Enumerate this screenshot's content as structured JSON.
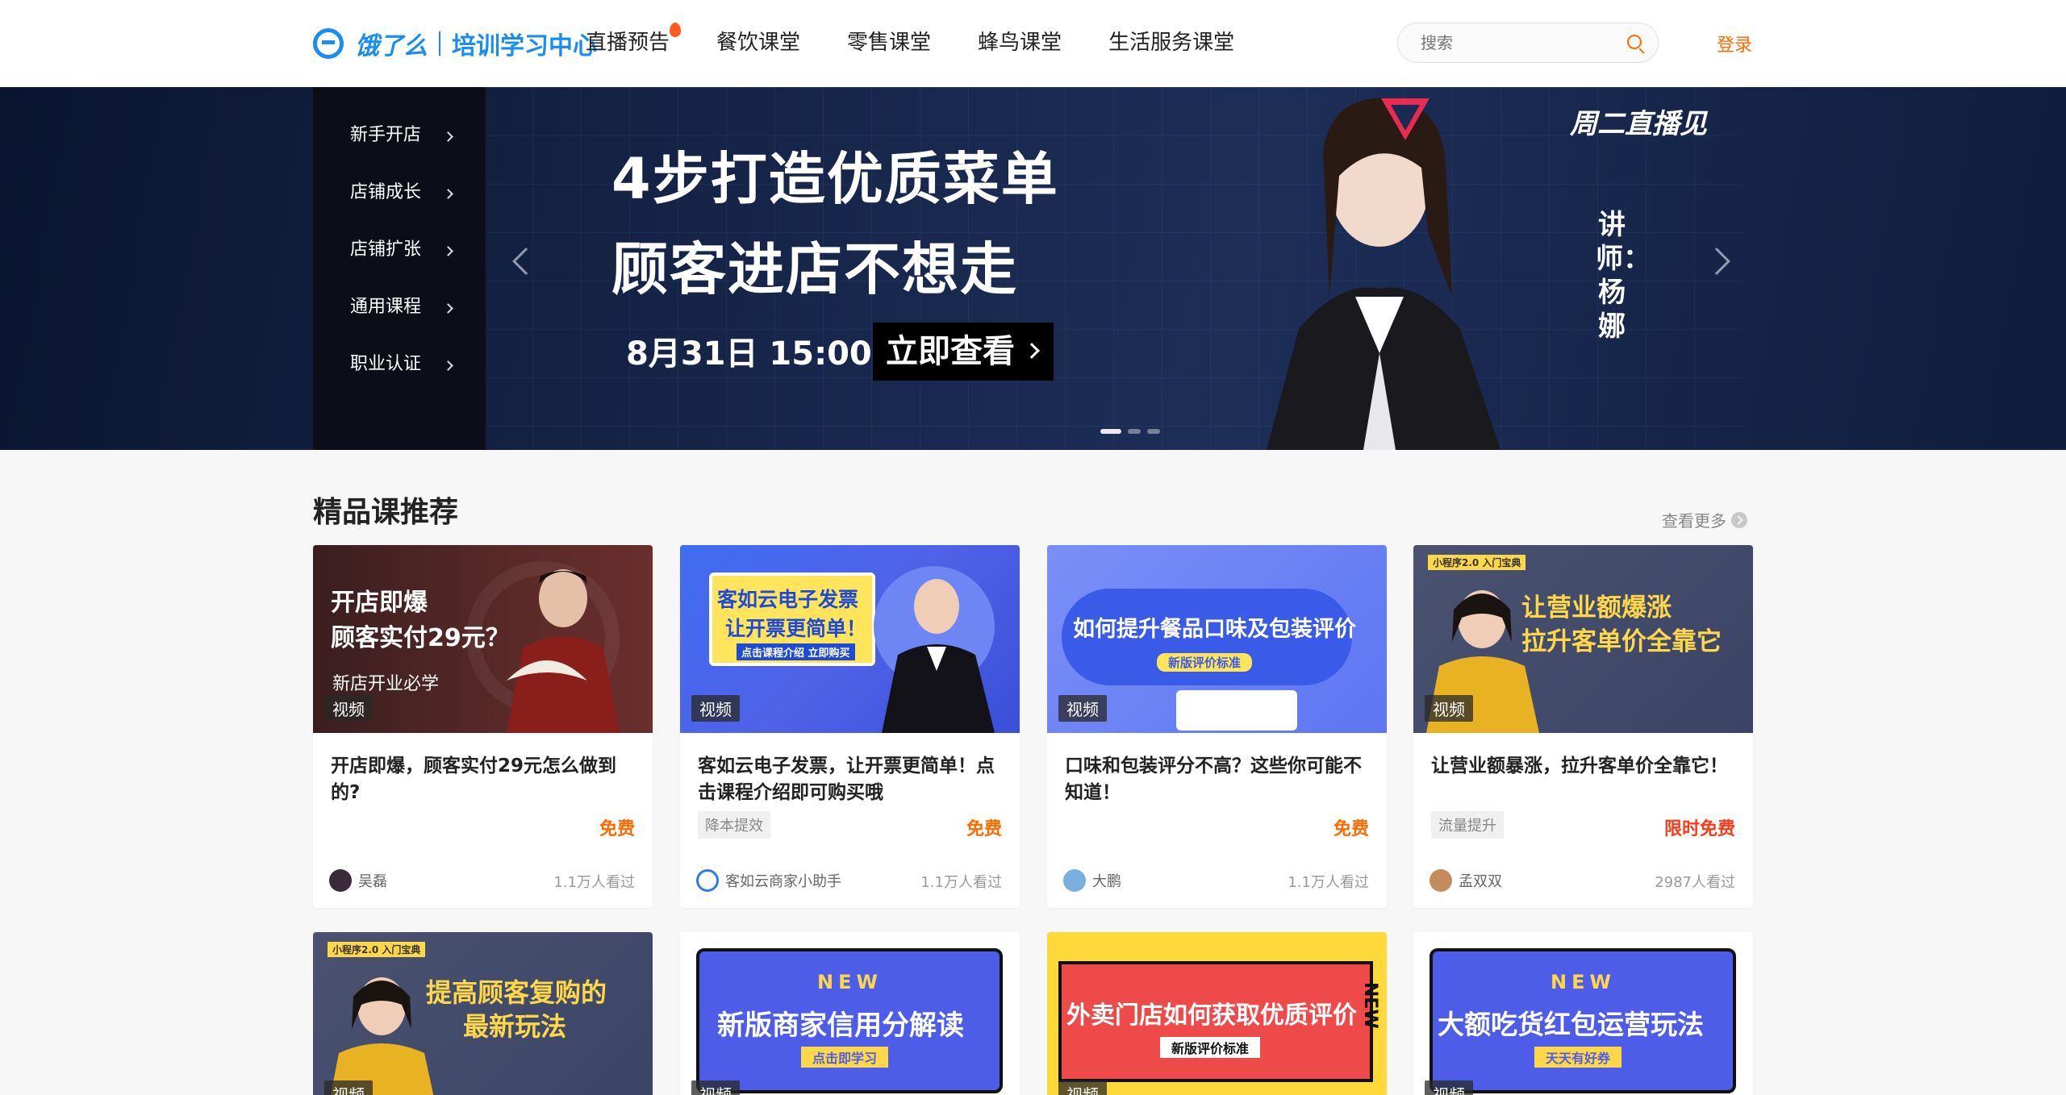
{
  "header": {
    "logo_name": "饿了么",
    "logo_sub": "培训学习中心",
    "nav": [
      "直播预告",
      "餐饮课堂",
      "零售课堂",
      "蜂鸟课堂",
      "生活服务课堂"
    ],
    "search_placeholder": "搜索",
    "login": "登录"
  },
  "side_menu": [
    "新手开店",
    "店铺成长",
    "店铺扩张",
    "通用课程",
    "职业认证"
  ],
  "banner": {
    "title1": "4步打造优质菜单",
    "title2": "顾客进店不想走",
    "date": "8月31日 15:00",
    "cta": "立即查看",
    "weekly": "周二直播见",
    "lecturer": "讲师：杨娜"
  },
  "section": {
    "title": "精品课推荐",
    "more": "查看更多"
  },
  "cards": [
    {
      "thumb_line1": "开店即爆",
      "thumb_line2": "顾客实付29元？",
      "thumb_line3": "新店开业必学",
      "thumb_tag": "视频",
      "title": "开店即爆，顾客实付29元怎么做到的?",
      "tag": "",
      "price": "免费",
      "author": "吴磊",
      "views": "1.1万人看过"
    },
    {
      "thumb_line1": "客如云电子发票",
      "thumb_line2": "让开票更简单！",
      "thumb_line3": "点击课程介绍 立即购买",
      "thumb_tag": "视频",
      "title": "客如云电子发票，让开票更简单！点击课程介绍即可购买哦",
      "tag": "降本提效",
      "price": "免费",
      "author": "客如云商家小助手",
      "views": "1.1万人看过"
    },
    {
      "thumb_line1": "如何提升餐品口味及包装评价",
      "thumb_line2": "新版评价标准",
      "thumb_line3": "",
      "thumb_tag": "视频",
      "title": "口味和包装评分不高？这些你可能不知道！",
      "tag": "",
      "price": "免费",
      "author": "大鹏",
      "views": "1.1万人看过"
    },
    {
      "thumb_line1": "让营业额爆涨",
      "thumb_line2": "拉升客单价全靠它",
      "thumb_line3": "小程序2.0 入门宝典",
      "thumb_tag": "视频",
      "title": "让营业额暴涨，拉升客单价全靠它！",
      "tag": "流量提升",
      "price": "限时免费",
      "author": "孟双双",
      "views": "2987人看过"
    }
  ],
  "cards_row2": [
    {
      "thumb_line1": "提高顾客复购的",
      "thumb_line2": "最新玩法",
      "thumb_line3": "小程序2.0 入门宝典",
      "thumb_tag": "视频"
    },
    {
      "thumb_line1": "NEW",
      "thumb_line2": "新版商家信用分解读",
      "thumb_line3": "点击即学习",
      "thumb_tag": "视频"
    },
    {
      "thumb_line1": "外卖门店如何获取优质评价",
      "thumb_line2": "新版评价标准",
      "thumb_line3": "NEW",
      "thumb_tag": "视频"
    },
    {
      "thumb_line1": "NEW",
      "thumb_line2": "大额吃货红包运营玩法",
      "thumb_line3": "天天有好券",
      "thumb_tag": "视频"
    }
  ],
  "colors": {
    "brand_blue": "#1b8df0",
    "accent_orange": "#ff6a00",
    "banner_bg": "#0e1a38"
  }
}
